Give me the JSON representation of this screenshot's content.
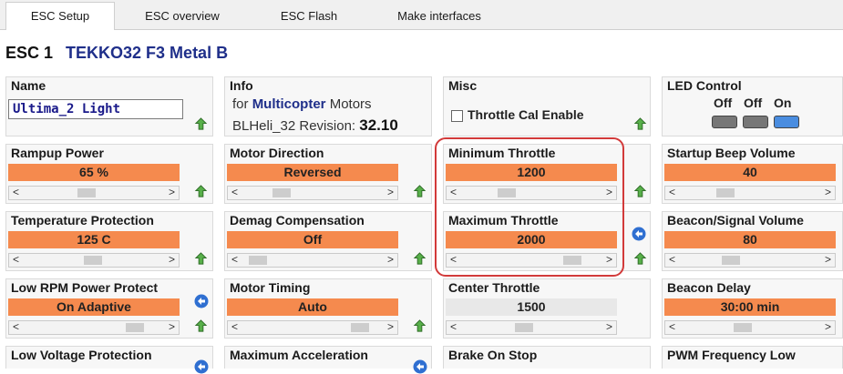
{
  "tabs": [
    {
      "label": "ESC Setup",
      "active": true
    },
    {
      "label": "ESC overview",
      "active": false
    },
    {
      "label": "ESC Flash",
      "active": false
    },
    {
      "label": "Make interfaces",
      "active": false
    }
  ],
  "header": {
    "esc": "ESC 1",
    "model": "TEKKO32 F3 Metal B"
  },
  "name": {
    "label": "Name",
    "value": "Ultima_2 Light"
  },
  "info": {
    "label": "Info",
    "for": "for",
    "type": "Multicopter",
    "motors": "Motors",
    "revision_label": "BLHeli_32 Revision:",
    "revision": "32.10"
  },
  "misc": {
    "label": "Misc",
    "throttle_cal": "Throttle Cal Enable",
    "checked": false
  },
  "led": {
    "label": "LED Control",
    "states": [
      "Off",
      "Off",
      "On"
    ],
    "colors": [
      "#777777",
      "#777777",
      "#4a8de0"
    ]
  },
  "params": {
    "rampup": {
      "label": "Rampup Power",
      "value": "65 %",
      "pos": 0.45
    },
    "motor_direction": {
      "label": "Motor Direction",
      "value": "Reversed",
      "pos": 0.25
    },
    "min_throttle": {
      "label": "Minimum Throttle",
      "value": "1200",
      "pos": 0.3
    },
    "beep": {
      "label": "Startup Beep Volume",
      "value": "40",
      "pos": 0.3
    },
    "temp": {
      "label": "Temperature Protection",
      "value": "125 C",
      "pos": 0.5
    },
    "demag": {
      "label": "Demag Compensation",
      "value": "Off",
      "pos": 0.05
    },
    "max_throttle": {
      "label": "Maximum Throttle",
      "value": "2000",
      "pos": 0.85
    },
    "beacon_volume": {
      "label": "Beacon/Signal Volume",
      "value": "80",
      "pos": 0.35
    },
    "low_rpm": {
      "label": "Low RPM Power Protect",
      "value": "On Adaptive",
      "pos": 0.85
    },
    "timing": {
      "label": "Motor Timing",
      "value": "Auto",
      "pos": 0.9
    },
    "center_throttle": {
      "label": "Center Throttle",
      "value": "1500",
      "pos": 0.45
    },
    "beacon_delay": {
      "label": "Beacon Delay",
      "value": "30:00 min",
      "pos": 0.45
    },
    "low_voltage": {
      "label": "Low Voltage Protection"
    },
    "max_accel": {
      "label": "Maximum Acceleration"
    },
    "brake": {
      "label": "Brake On Stop"
    },
    "pwm_low": {
      "label": "PWM Frequency Low"
    }
  },
  "colors": {
    "accent": "#f58a4e",
    "title_blue": "#1f2f8a",
    "highlight": "#d23a3a"
  }
}
